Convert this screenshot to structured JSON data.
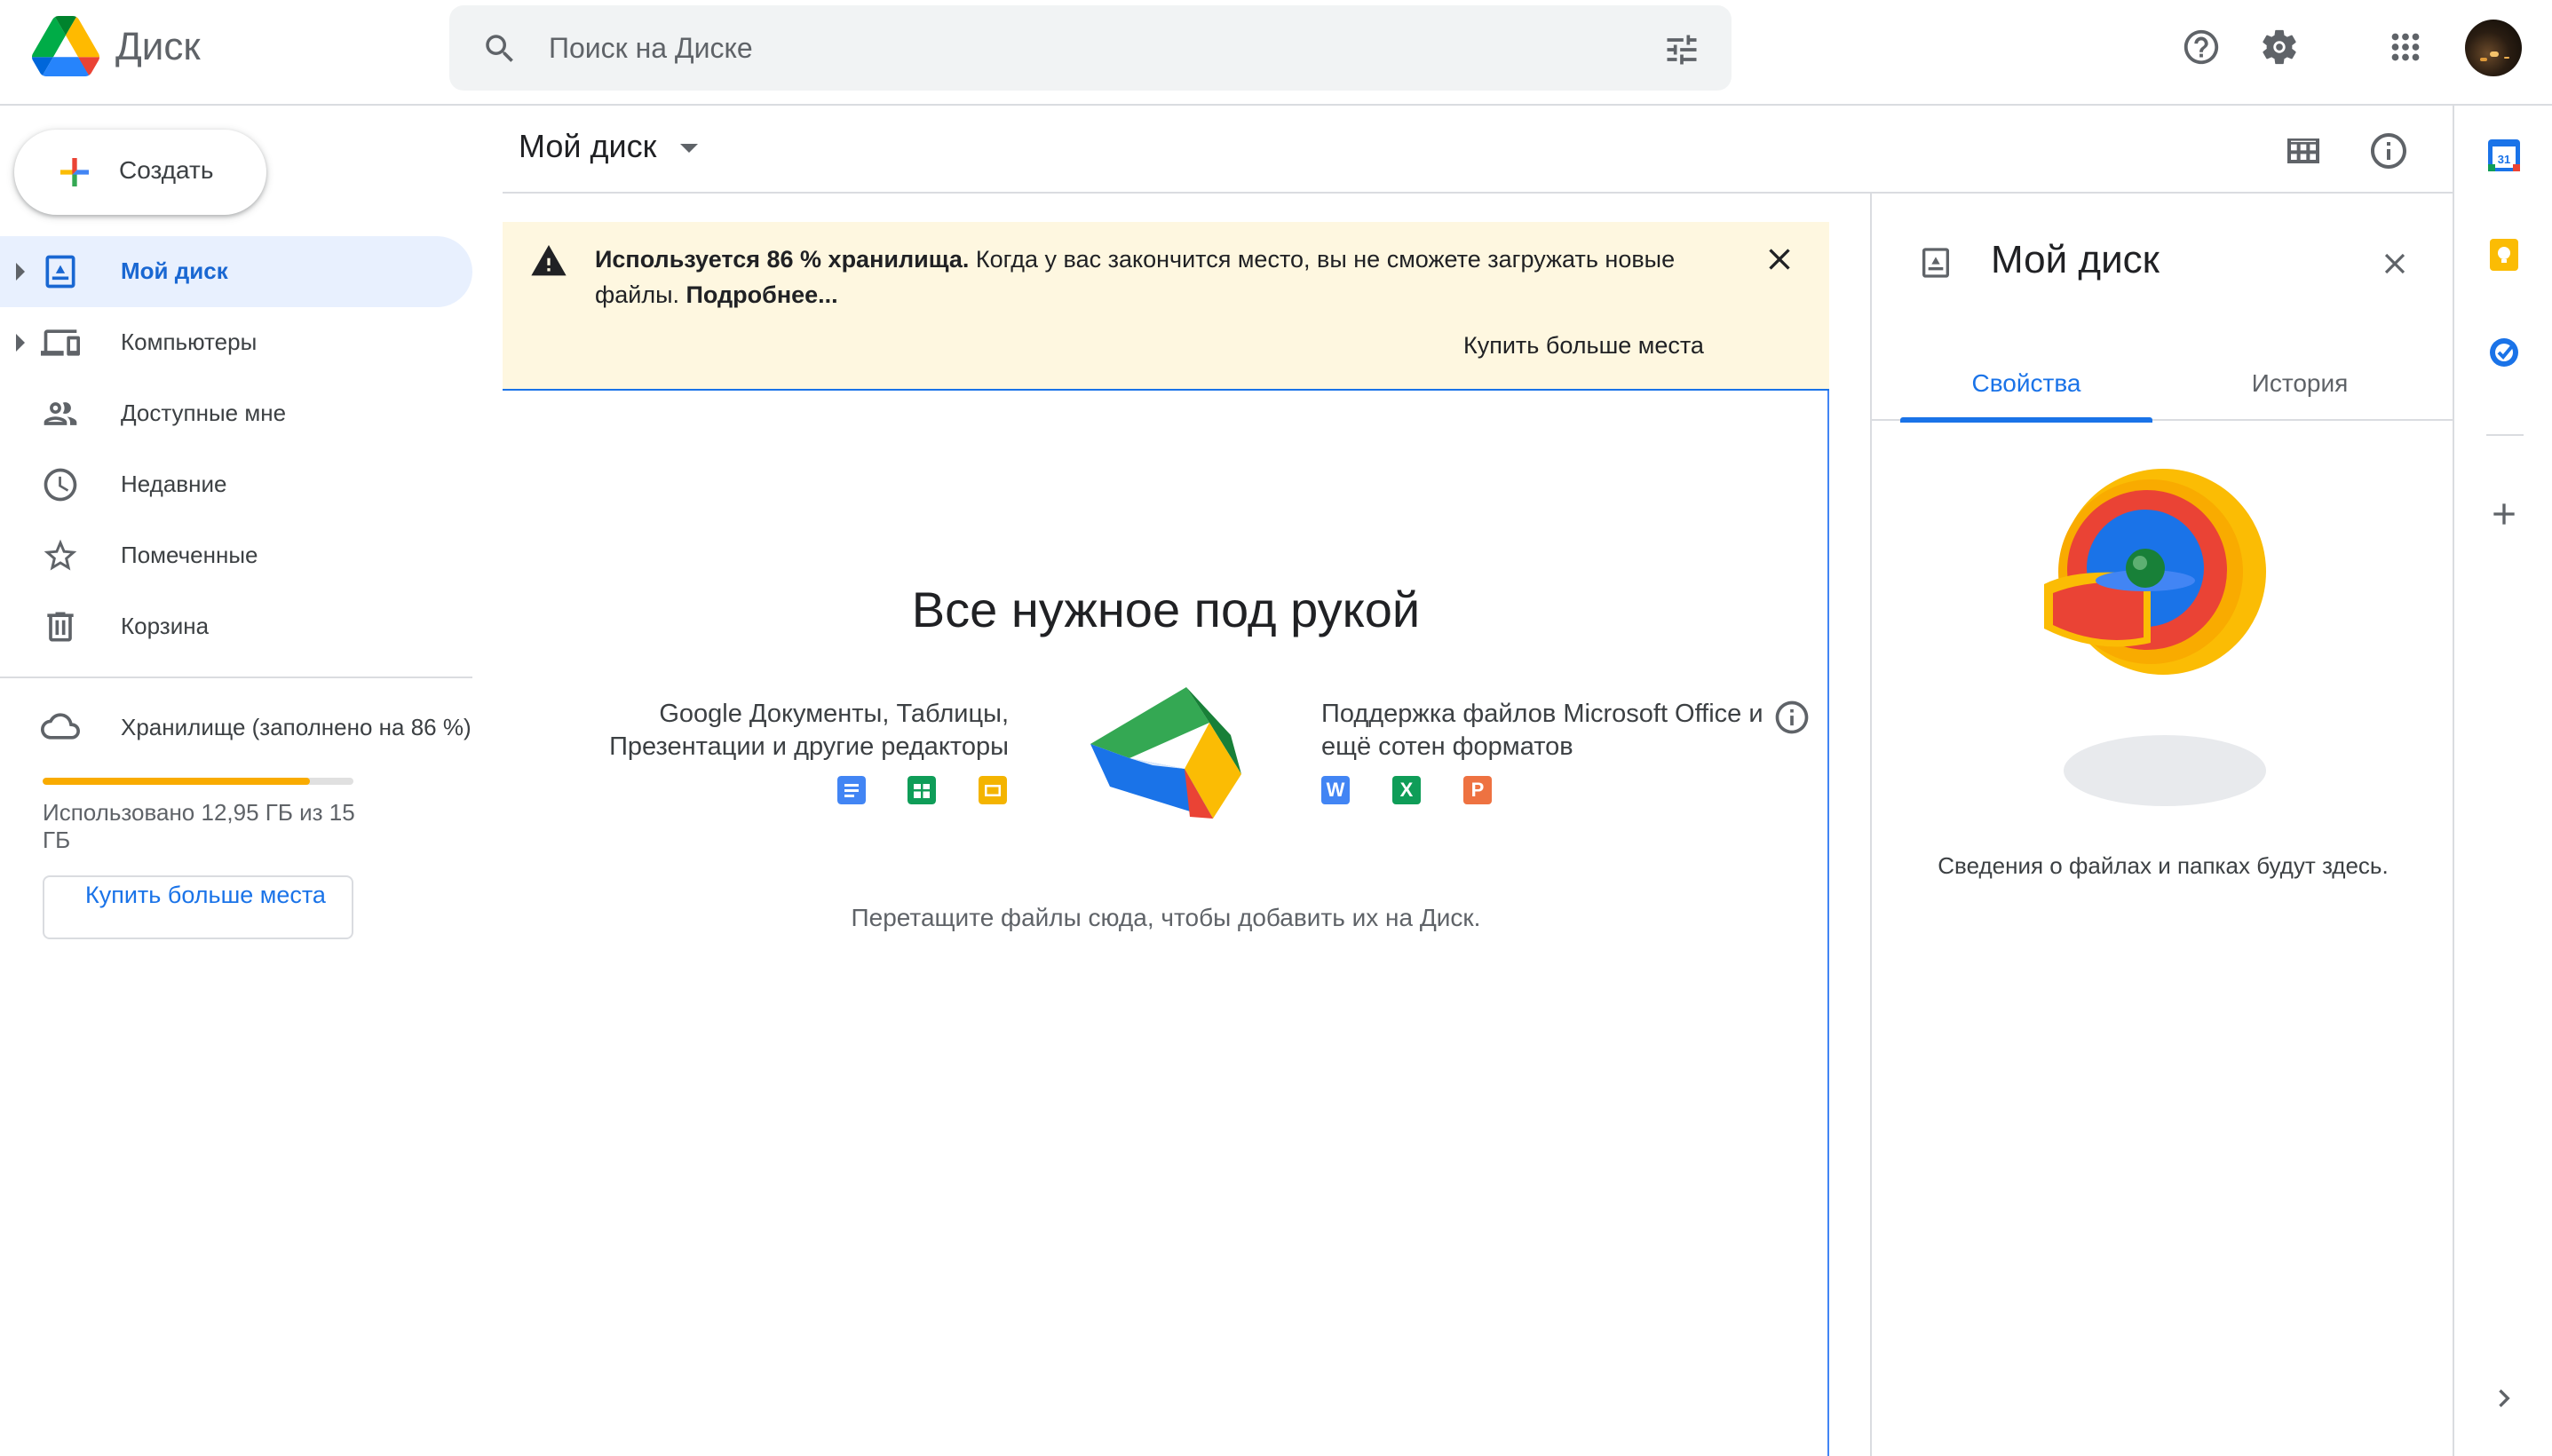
{
  "header": {
    "app_name": "Диск",
    "search_placeholder": "Поиск на Диске"
  },
  "sidebar": {
    "create_label": "Создать",
    "items": [
      {
        "label": "Мой диск",
        "icon": "my-drive-icon",
        "active": true
      },
      {
        "label": "Компьютеры",
        "icon": "computers-icon"
      },
      {
        "label": "Доступные мне",
        "icon": "shared-icon"
      },
      {
        "label": "Недавние",
        "icon": "clock-icon"
      },
      {
        "label": "Помеченные",
        "icon": "star-icon"
      },
      {
        "label": "Корзина",
        "icon": "trash-icon"
      }
    ],
    "storage_label": "Хранилище (заполнено на 86 %)",
    "storage_used_text": "Использовано 12,95 ГБ из 15 ГБ",
    "storage_fraction": 0.86,
    "buy_label": "Купить больше места"
  },
  "main": {
    "path_title": "Мой диск",
    "banner": {
      "bold_text": "Используется 86 % хранилища.",
      "text": " Когда у вас закончится место, вы не сможете загружать новые файлы. ",
      "link": "Подробнее...",
      "action": "Купить больше места"
    },
    "empty_title": "Все нужное под рукой",
    "left_feature": "Google Документы, Таблицы, Презентации и другие редакторы",
    "right_feature": "Поддержка файлов Microsoft Office и ещё сотен форматов",
    "office_icons": [
      "W",
      "X",
      "P"
    ],
    "drop_hint": "Перетащите файлы сюда, чтобы добавить их на Диск."
  },
  "details": {
    "title": "Мой диск",
    "tabs": [
      "Свойства",
      "История"
    ],
    "message": "Сведения о файлах и папках будут здесь."
  },
  "rail": {
    "calendar_day": "31"
  },
  "colors": {
    "accent": "#1a73e8",
    "active_bg": "#e8f0fe",
    "banner_bg": "#fef7e0",
    "storage_fill": "#f9ab00"
  }
}
